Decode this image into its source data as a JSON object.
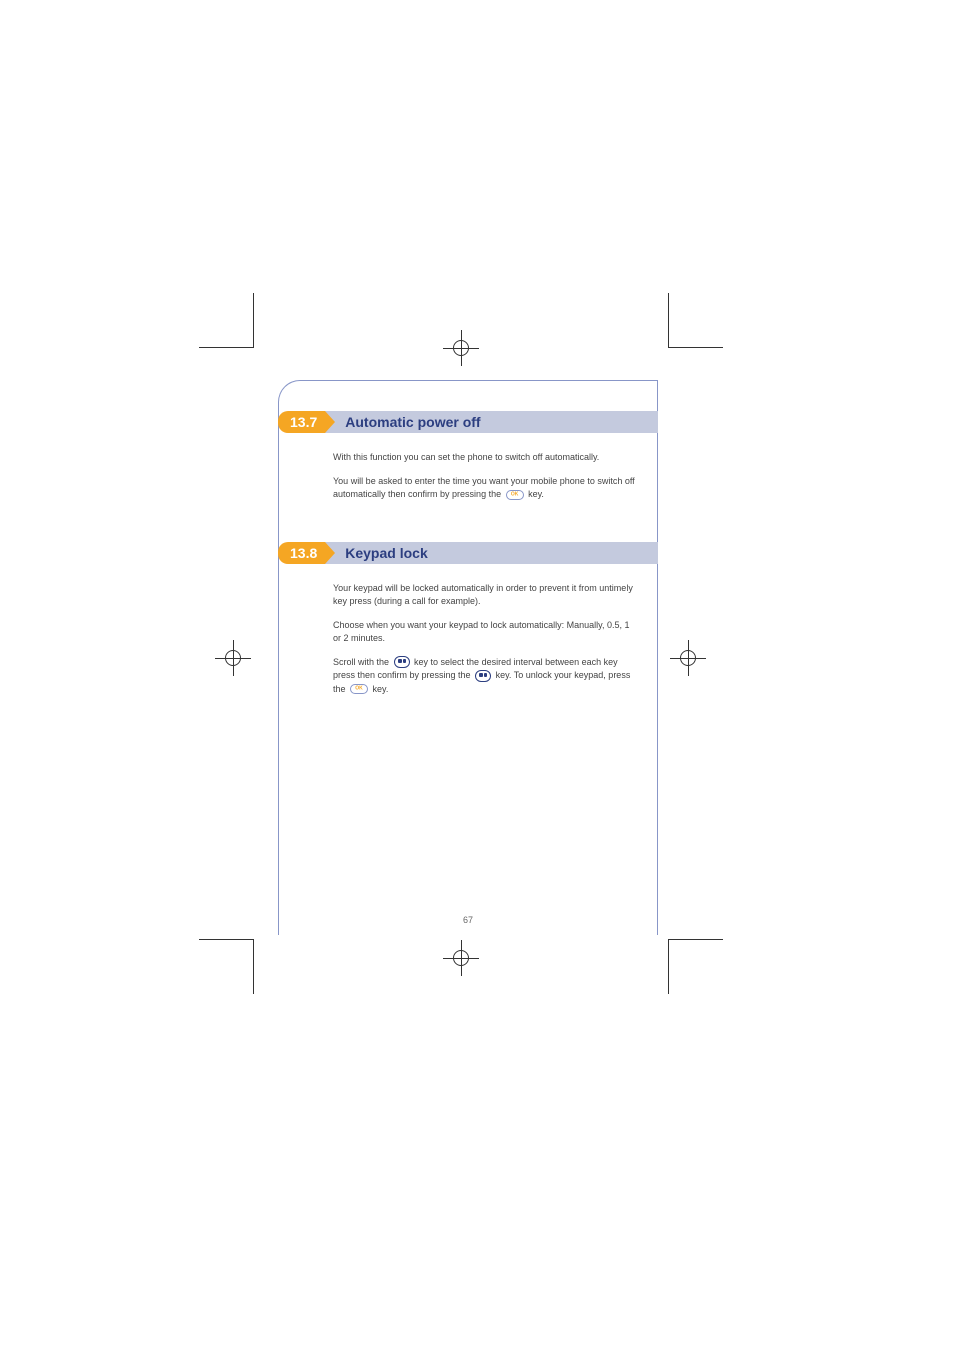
{
  "sections": [
    {
      "tag": "13.7",
      "title": "Automatic power off",
      "paragraphs": [
        "With this function you can set the phone to switch off automatically.",
        "You will be asked to enter the time you want your mobile phone to switch off automatically then confirm by pressing the {OK} key."
      ]
    },
    {
      "tag": "13.8",
      "title": "Keypad lock",
      "paragraphs": [
        "Your keypad will be locked automatically in order to prevent it from untimely key press (during a call for example).",
        "Choose when you want your keypad to lock automatically: Manually, 0.5, 1 or 2 minutes.",
        "Scroll with the {NAV} key to select the desired interval between each key press then confirm by pressing the {NAV} key. To unlock your keypad, press the {OK} key."
      ]
    }
  ],
  "page_number": "67"
}
